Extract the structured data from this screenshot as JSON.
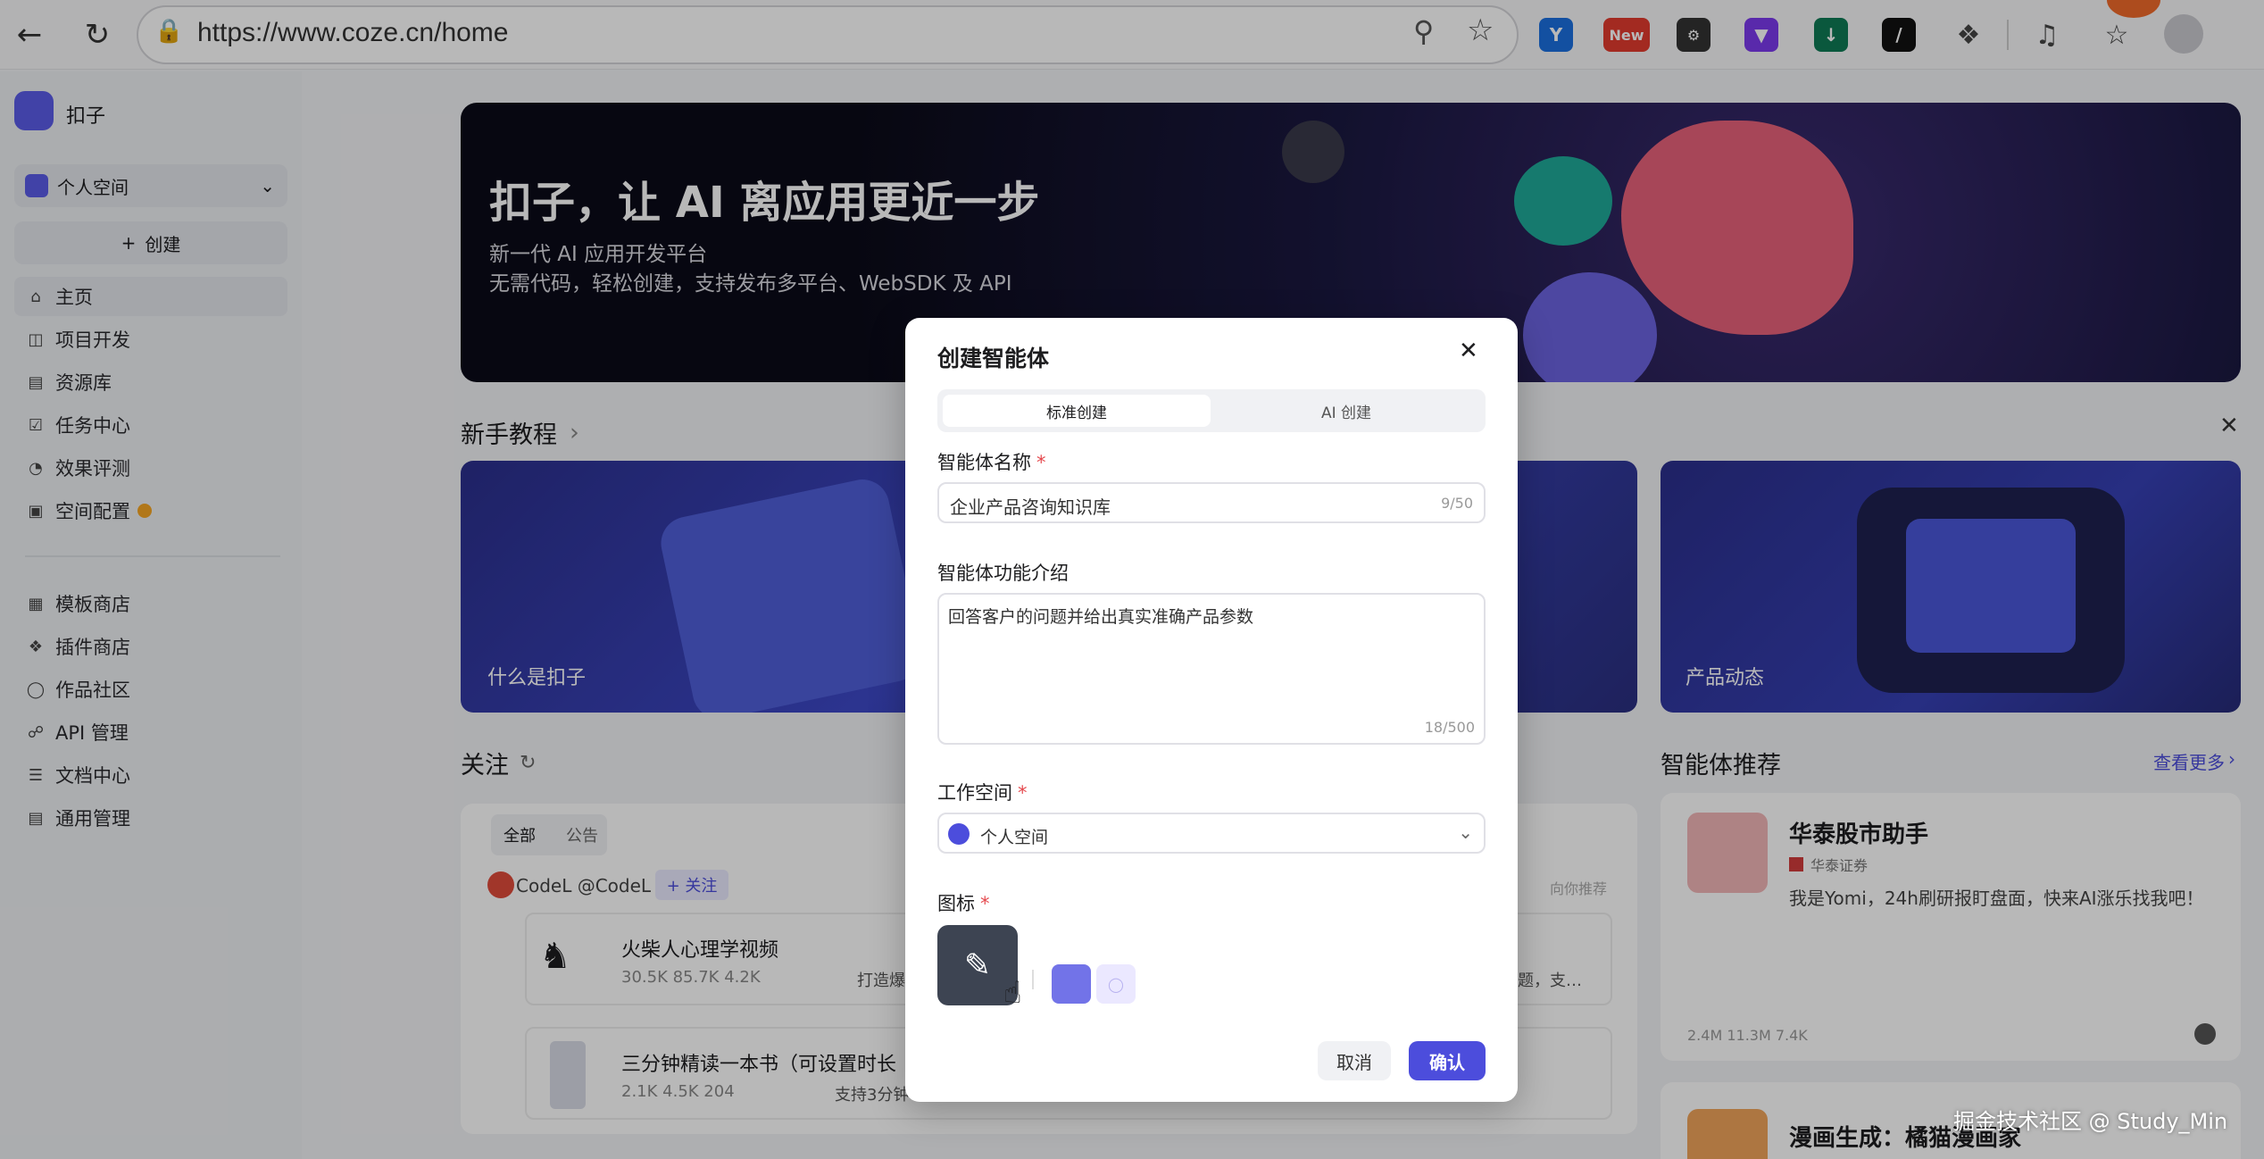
{
  "browser": {
    "url": "https://www.coze.cn/home",
    "ext_new": "New"
  },
  "sidebar": {
    "brand": "扣子",
    "space": "个人空间",
    "create": "创建",
    "nav": [
      {
        "label": "主页",
        "icon": "home-icon"
      },
      {
        "label": "项目开发",
        "icon": "project-icon"
      },
      {
        "label": "资源库",
        "icon": "library-icon"
      },
      {
        "label": "任务中心",
        "icon": "task-icon"
      },
      {
        "label": "效果评测",
        "icon": "evaluate-icon"
      },
      {
        "label": "空间配置",
        "icon": "space-config-icon"
      }
    ],
    "nav2": [
      {
        "label": "模板商店",
        "icon": "template-icon"
      },
      {
        "label": "插件商店",
        "icon": "plugin-icon"
      },
      {
        "label": "作品社区",
        "icon": "community-icon"
      },
      {
        "label": "API 管理",
        "icon": "api-icon"
      },
      {
        "label": "文档中心",
        "icon": "docs-icon"
      },
      {
        "label": "通用管理",
        "icon": "settings-icon"
      }
    ]
  },
  "banner": {
    "title": "扣子，让 AI 离应用更近一步",
    "line1": "新一代 AI 应用开发平台",
    "line2": "无需代码，轻松创建，支持发布多平台、WebSDK 及 API"
  },
  "tutorial": {
    "heading": "新手教程",
    "cards": [
      "什么是扣子",
      "产品动态"
    ]
  },
  "follow": {
    "heading": "关注",
    "tabs": [
      "全部",
      "公告"
    ],
    "author": "CodeL @CodeL",
    "follow_btn": "+ 关注",
    "recommend_tag": "向你推荐",
    "items": [
      {
        "title": "火柴人心理学视频",
        "stats": "30.5K  85.7K  4.2K",
        "desc": "打造爆",
        "desc_right": "题，支…"
      },
      {
        "title": "三分钟精读一本书（可设置时长",
        "stats": "2.1K  4.5K  204",
        "desc": "支持3分钟"
      }
    ]
  },
  "agents": {
    "heading": "智能体推荐",
    "more": "查看更多",
    "card1": {
      "name": "华泰股市助手",
      "org": "华泰证券",
      "desc": "我是Yomi，24h刷研报盯盘面，快来AI涨乐找我吧！",
      "stats": "2.4M   11.3M   7.4K"
    },
    "card2": {
      "name": "漫画生成：橘猫漫画家"
    }
  },
  "modal": {
    "title": "创建智能体",
    "tabs": [
      "标准创建",
      "AI 创建"
    ],
    "name_label": "智能体名称",
    "name_value": "企业产品咨询知识库",
    "name_count": "9/50",
    "desc_label": "智能体功能介绍",
    "desc_value": "回答客户的问题并给出真实准确产品参数",
    "desc_count": "18/500",
    "space_label": "工作空间",
    "space_value": "个人空间",
    "icon_label": "图标",
    "required_mark": "*",
    "cancel": "取消",
    "confirm": "确认"
  },
  "watermark": "掘金技术社区 @ Study_Min",
  "colors": {
    "accent": "#4c4ddc",
    "required": "#e5484d"
  }
}
